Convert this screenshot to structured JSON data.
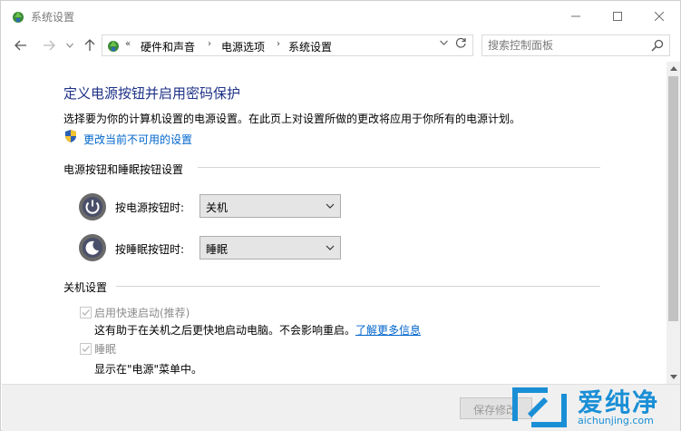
{
  "window": {
    "title": "系统设置",
    "icon": "control-panel-icon"
  },
  "nav": {
    "breadcrumb": [
      "硬件和声音",
      "电源选项",
      "系统设置"
    ],
    "search_placeholder": "搜索控制面板"
  },
  "main": {
    "title": "定义电源按钮并启用密码保护",
    "description": "选择要为你的计算机设置的电源设置。在此页上对设置所做的更改将应用于你所有的电源计划。",
    "change_link": "更改当前不可用的设置",
    "power_group": {
      "header": "电源按钮和睡眠按钮设置",
      "rows": [
        {
          "label": "按电源按钮时:",
          "value": "关机",
          "icon": "power-button-icon"
        },
        {
          "label": "按睡眠按钮时:",
          "value": "睡眠",
          "icon": "sleep-button-icon"
        }
      ]
    },
    "shutdown_group": {
      "header": "关机设置",
      "options": [
        {
          "label": "启用快速启动(推荐)",
          "checked": true,
          "enabled": false,
          "detail": "这有助于在关机之后更快地启动电脑。不会影响重启。",
          "detail_link": "了解更多信息"
        },
        {
          "label": "睡眠",
          "checked": true,
          "enabled": false,
          "detail": "显示在\"电源\"菜单中。"
        }
      ]
    }
  },
  "footer": {
    "save_label": "保存修改"
  },
  "watermark": {
    "title": "爱纯净",
    "url": "aichunjing.com"
  },
  "colors": {
    "title_blue": "#1e3287",
    "link_blue": "#0066cc",
    "watermark_blue": "#1a8fd6"
  }
}
